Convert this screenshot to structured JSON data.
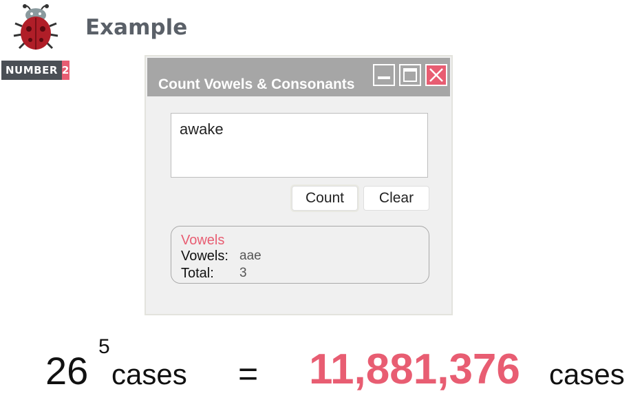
{
  "header": {
    "title": "Example",
    "badge_word": "NUMBER",
    "badge_number": "2"
  },
  "window": {
    "title": "Count Vowels & Consonants",
    "textarea_value": "awake",
    "count_label": "Count",
    "clear_label": "Clear",
    "result": {
      "legend": "Vowels",
      "vowels_label": "Vowels:",
      "vowels_value": "aae",
      "total_label": "Total:",
      "total_value": "3"
    }
  },
  "formula": {
    "base": "26",
    "exponent": "5",
    "unit_left": "cases",
    "equals": "=",
    "result": "11,881,376",
    "unit_right": "cases"
  },
  "colors": {
    "accent": "#e85d72",
    "titlebar": "#a6a6a6",
    "heading": "#5a6068"
  },
  "icons": [
    "ladybug-logo-icon",
    "minimize-icon",
    "maximize-icon",
    "close-icon"
  ]
}
